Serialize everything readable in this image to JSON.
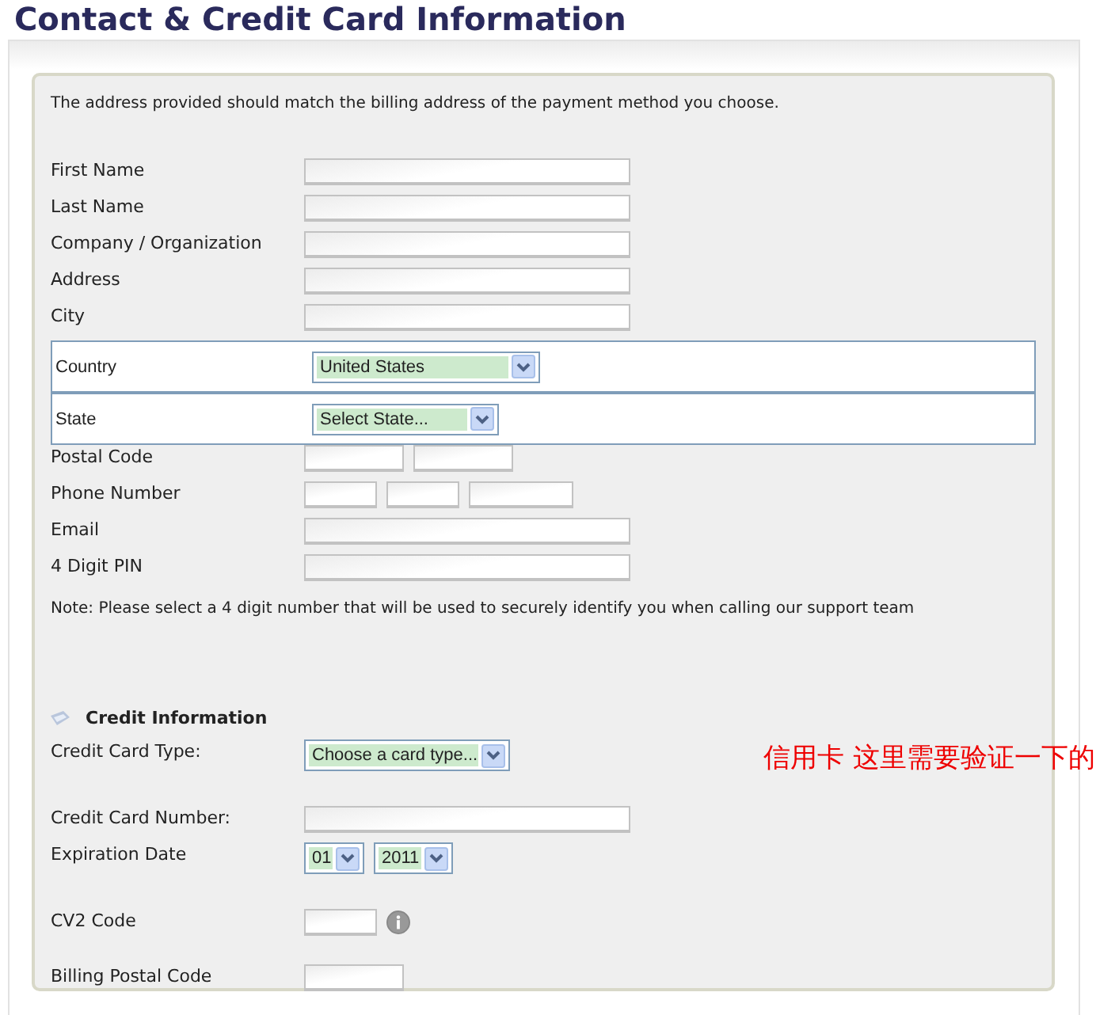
{
  "title": "Contact & Credit Card Information",
  "intro": "The address provided should match the billing address of the payment method you choose.",
  "contact_rows": [
    {
      "label": "First Name",
      "fields": [
        {
          "kind": "long"
        }
      ]
    },
    {
      "label": "Last Name",
      "fields": [
        {
          "kind": "long"
        }
      ]
    },
    {
      "label": "Company / Organization",
      "fields": [
        {
          "kind": "long"
        }
      ]
    },
    {
      "label": "Address",
      "fields": [
        {
          "kind": "long"
        }
      ]
    },
    {
      "label": "City",
      "fields": [
        {
          "kind": "long"
        }
      ]
    },
    {
      "label": "Country",
      "fields": [
        {
          "kind": "select-wide",
          "value": "United States"
        }
      ]
    },
    {
      "label": "State",
      "fields": [
        {
          "kind": "select-medium",
          "value": "Select State..."
        }
      ]
    },
    {
      "label": "Postal Code",
      "fields": [
        {
          "kind": "medium"
        },
        {
          "kind": "medium"
        }
      ]
    },
    {
      "label": "Phone Number",
      "fields": [
        {
          "kind": "small"
        },
        {
          "kind": "small"
        },
        {
          "kind": "wide"
        }
      ]
    },
    {
      "label": "Email",
      "fields": [
        {
          "kind": "long"
        }
      ]
    },
    {
      "label": "4 Digit PIN",
      "fields": [
        {
          "kind": "long"
        }
      ]
    }
  ],
  "note": "Note: Please select a 4 digit number that will be used to securely identify you when calling our support team",
  "credit": {
    "heading": "Credit Information",
    "annotation": "信用卡  这里需要验证一下的",
    "rows": [
      {
        "label": "Credit Card Type:",
        "fields": [
          {
            "kind": "select-card",
            "value": "Choose a card type..."
          }
        ]
      },
      {
        "label": "Credit Card Number:",
        "fields": [
          {
            "kind": "long"
          }
        ]
      },
      {
        "label": "Expiration Date",
        "fields": [
          {
            "kind": "select-tiny",
            "value": "01"
          },
          {
            "kind": "select-small",
            "value": "2011"
          }
        ]
      },
      {
        "label": "CV2 Code",
        "fields": [
          {
            "kind": "small"
          },
          {
            "kind": "info"
          }
        ]
      },
      {
        "label": "Billing Postal Code",
        "fields": [
          {
            "kind": "medium"
          }
        ]
      }
    ]
  }
}
